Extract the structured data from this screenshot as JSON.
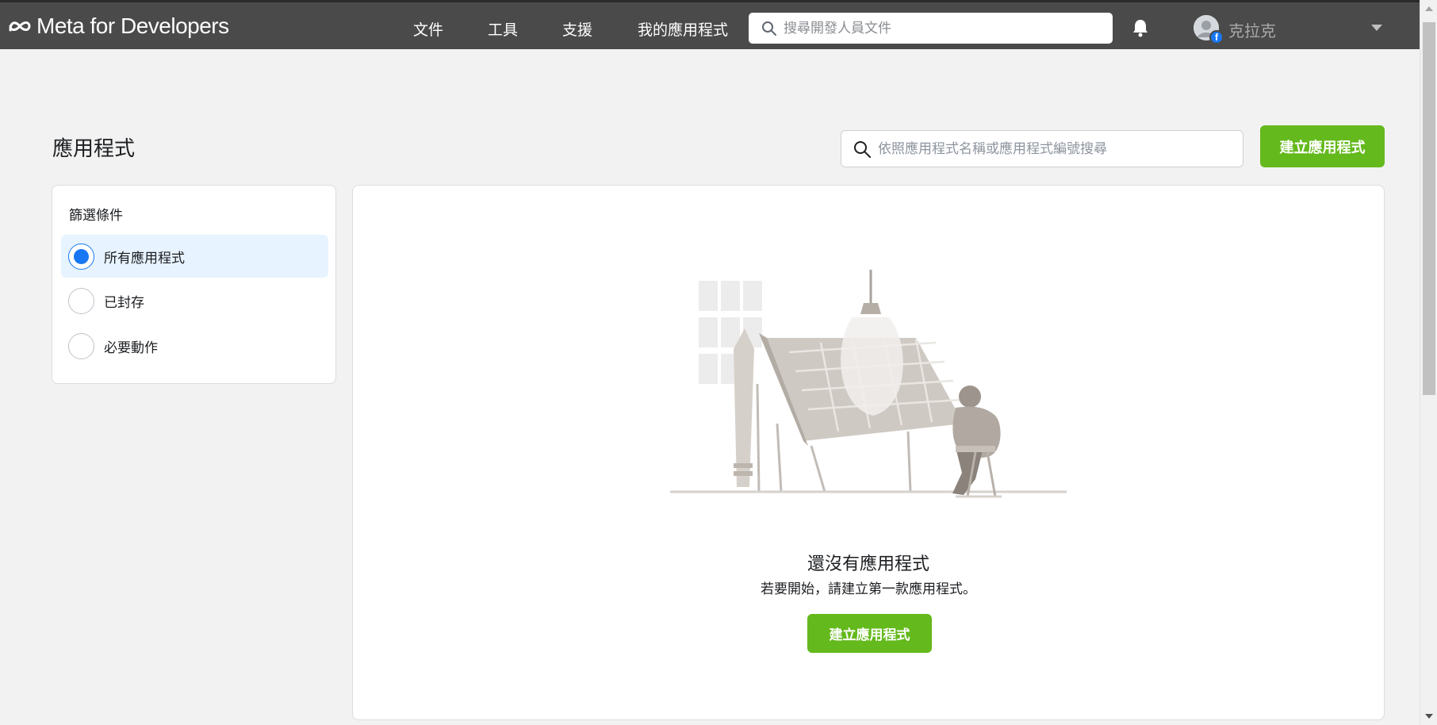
{
  "brand": {
    "name": "Meta for Developers"
  },
  "nav": {
    "links": [
      "文件",
      "工具",
      "支援",
      "我的應用程式"
    ],
    "search_placeholder": "搜尋開發人員文件",
    "username": "克拉克"
  },
  "page": {
    "title": "應用程式",
    "search_placeholder": "依照應用程式名稱或應用程式編號搜尋",
    "create_button": "建立應用程式"
  },
  "filters": {
    "title": "篩選條件",
    "options": [
      {
        "label": "所有應用程式",
        "selected": true
      },
      {
        "label": "已封存",
        "selected": false
      },
      {
        "label": "必要動作",
        "selected": false
      }
    ]
  },
  "empty_state": {
    "title": "還沒有應用程式",
    "subtitle": "若要開始，請建立第一款應用程式。",
    "button": "建立應用程式"
  },
  "colors": {
    "topbar": "#4a4a4a",
    "accent_green": "#64b91c",
    "selected_bg": "#e7f3ff",
    "radio_blue": "#1877f2"
  },
  "icons": [
    "meta-logo-icon",
    "search-icon",
    "bell-icon",
    "facebook-badge-icon",
    "chevron-down-icon"
  ]
}
